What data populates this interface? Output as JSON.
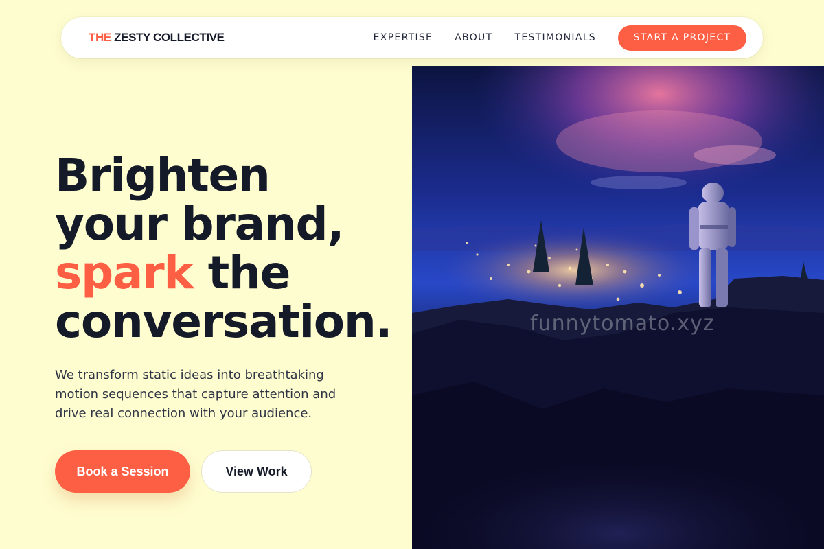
{
  "nav": {
    "brand_accent": "THE",
    "brand_rest": "ZESTY COLLECTIVE",
    "links": [
      "EXPERTISE",
      "ABOUT",
      "TESTIMONIALS"
    ],
    "cta": "START A PROJECT"
  },
  "hero": {
    "headline_line1": "Brighten",
    "headline_line2": "your brand,",
    "headline_highlight": "spark",
    "headline_line3_rest": "the",
    "headline_line4": "conversation.",
    "description": "We transform static ideas into breathtaking motion sequences that capture attention and drive real connection with your audience.",
    "primary_button": "Book a Session",
    "secondary_button": "View Work",
    "image_watermark": "funnytomato.xyz"
  },
  "colors": {
    "background": "#fefdd0",
    "accent": "#fd5f45",
    "text": "#151a28"
  }
}
